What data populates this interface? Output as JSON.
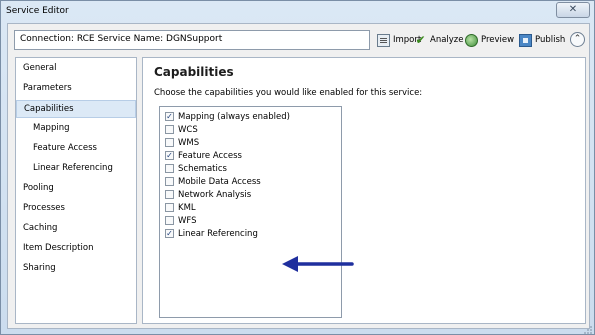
{
  "window": {
    "title": "Service Editor",
    "close_glyph": "✕"
  },
  "toolbar": {
    "connection_text": "Connection: RCE   Service Name: DGNSupport",
    "buttons": [
      {
        "label": "Import",
        "icon": "import-icon"
      },
      {
        "label": "Analyze",
        "icon": "checkmark-icon"
      },
      {
        "label": "Preview",
        "icon": "globe-icon"
      },
      {
        "label": "Publish",
        "icon": "publish-icon"
      }
    ],
    "collapse_glyph": "⌃"
  },
  "sidebar": {
    "items": [
      {
        "label": "General"
      },
      {
        "label": "Parameters"
      },
      {
        "label": "Capabilities",
        "selected": true
      },
      {
        "label": "Mapping",
        "sub": true
      },
      {
        "label": "Feature Access",
        "sub": true
      },
      {
        "label": "Linear Referencing",
        "sub": true
      },
      {
        "label": "Pooling"
      },
      {
        "label": "Processes"
      },
      {
        "label": "Caching"
      },
      {
        "label": "Item Description"
      },
      {
        "label": "Sharing"
      }
    ]
  },
  "main": {
    "heading": "Capabilities",
    "description": "Choose the capabilities you would like enabled for this service:",
    "capabilities": [
      {
        "label": "Mapping (always enabled)",
        "checked": true
      },
      {
        "label": "WCS",
        "checked": false
      },
      {
        "label": "WMS",
        "checked": false
      },
      {
        "label": "Feature Access",
        "checked": true
      },
      {
        "label": "Schematics",
        "checked": false
      },
      {
        "label": "Mobile Data Access",
        "checked": false
      },
      {
        "label": "Network Analysis",
        "checked": false
      },
      {
        "label": "KML",
        "checked": false
      },
      {
        "label": "WFS",
        "checked": false
      },
      {
        "label": "Linear Referencing",
        "checked": true
      }
    ],
    "check_glyph": "✓"
  },
  "colors": {
    "arrow": "#1f2f9e",
    "selection": "#dce9f6",
    "window_frame": "#cbdcee"
  }
}
